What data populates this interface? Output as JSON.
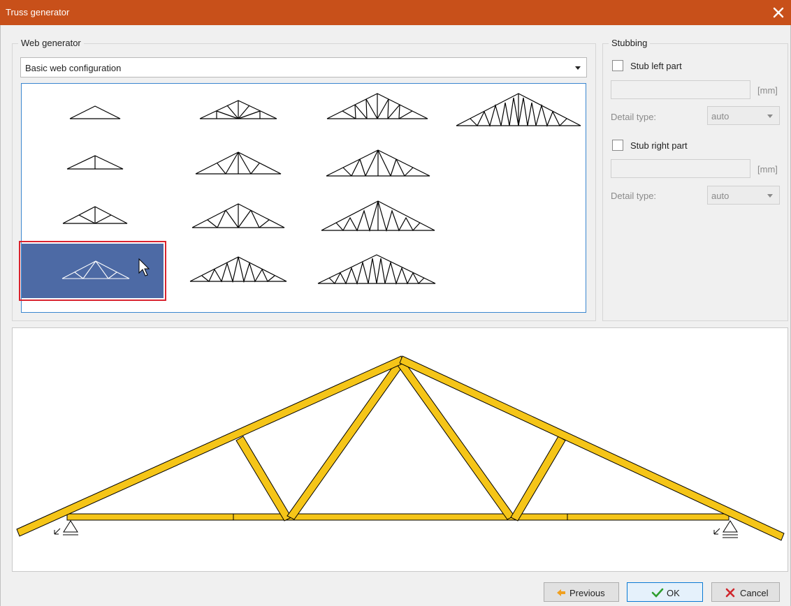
{
  "window": {
    "title": "Truss generator"
  },
  "web_generator": {
    "legend": "Web generator",
    "config_select": {
      "value": "Basic web configuration"
    }
  },
  "stubbing": {
    "legend": "Stubbing",
    "left": {
      "label": "Stub left part",
      "checked": false,
      "unit": "[mm]",
      "detail_label": "Detail type:",
      "detail_value": "auto"
    },
    "right": {
      "label": "Stub right part",
      "checked": false,
      "unit": "[mm]",
      "detail_label": "Detail type:",
      "detail_value": "auto"
    }
  },
  "buttons": {
    "previous": "Previous",
    "ok": "OK",
    "cancel": "Cancel"
  },
  "colors": {
    "title_bar": "#c8501a",
    "selection": "#4d6aa5",
    "selection_outline": "#d9232e",
    "member": "#f5c518",
    "ok_icon": "#2e9e2e",
    "cancel_icon": "#d0262c",
    "previous_icon": "#f0a020"
  },
  "icons": [
    "close-icon",
    "dropdown-arrow-icon",
    "cursor-icon",
    "arrow-left-icon",
    "checkmark-icon",
    "x-icon",
    "support-icon"
  ]
}
